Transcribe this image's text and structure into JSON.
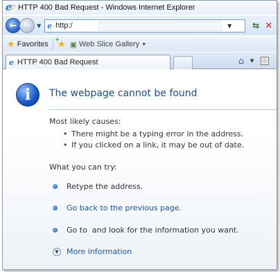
{
  "window": {
    "title": "HTTP 400 Bad Request - Windows Internet Explorer"
  },
  "address_bar": {
    "url": "http:/"
  },
  "favorites_bar": {
    "favorites_label": "Favorites",
    "web_slice_label": "Web Slice Gallery"
  },
  "tab": {
    "label": "HTTP 400 Bad Request"
  },
  "page": {
    "heading": "The webpage cannot be found",
    "causes_title": "Most likely causes:",
    "causes": [
      "There might be a typing error in the address.",
      "If you clicked on a link, it may be out of date."
    ],
    "try_title": "What you can try:",
    "try_items": [
      "Retype the address.",
      "Go back to the previous page.",
      "Go to  and look for the information you want."
    ],
    "more_info": "More information"
  },
  "colors": {
    "heading": "#1a4f93",
    "link": "#1a56b0",
    "accent": "#1a55c4"
  },
  "icons": [
    "ie-logo-icon",
    "back-icon",
    "forward-icon",
    "refresh-icon",
    "stop-icon",
    "star-icon",
    "add-favorite-icon",
    "web-slice-icon",
    "home-icon",
    "feed-icon",
    "info-icon",
    "bullet-icon",
    "chevron-down-icon"
  ]
}
